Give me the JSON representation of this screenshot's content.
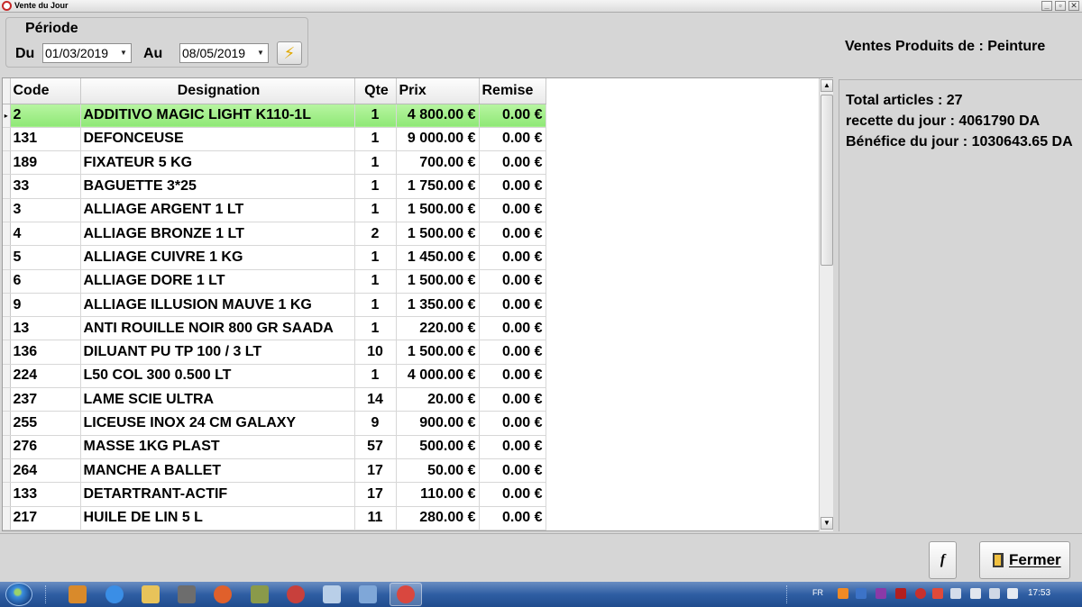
{
  "window": {
    "title": "Vente du Jour",
    "buttons": {
      "minimize": "_",
      "maximize": "▫",
      "close": "✕"
    }
  },
  "periode": {
    "title": "Période",
    "from_label": "Du",
    "from_value": "01/03/2019",
    "to_label": "Au",
    "to_value": "08/05/2019",
    "refresh_icon": "lightning-icon"
  },
  "header": {
    "ventes_label": "Ventes Produits de : Peinture"
  },
  "grid": {
    "columns": [
      "Code",
      "Designation",
      "Qte",
      "Prix",
      "Remise"
    ],
    "rows": [
      {
        "code": "2",
        "designation": "ADDITIVO MAGIC LIGHT K110-1L",
        "qte": "1",
        "prix": "4 800.00 €",
        "remise": "0.00 €",
        "selected": true
      },
      {
        "code": "131",
        "designation": "DEFONCEUSE",
        "qte": "1",
        "prix": "9 000.00 €",
        "remise": "0.00 €"
      },
      {
        "code": "189",
        "designation": "FIXATEUR 5 KG",
        "qte": "1",
        "prix": "700.00 €",
        "remise": "0.00 €"
      },
      {
        "code": "33",
        "designation": "BAGUETTE 3*25",
        "qte": "1",
        "prix": "1 750.00 €",
        "remise": "0.00 €"
      },
      {
        "code": "3",
        "designation": "ALLIAGE ARGENT 1 LT",
        "qte": "1",
        "prix": "1 500.00 €",
        "remise": "0.00 €"
      },
      {
        "code": "4",
        "designation": "ALLIAGE BRONZE 1 LT",
        "qte": "2",
        "prix": "1 500.00 €",
        "remise": "0.00 €"
      },
      {
        "code": "5",
        "designation": "ALLIAGE CUIVRE 1 KG",
        "qte": "1",
        "prix": "1 450.00 €",
        "remise": "0.00 €"
      },
      {
        "code": "6",
        "designation": "ALLIAGE DORE 1 LT",
        "qte": "1",
        "prix": "1 500.00 €",
        "remise": "0.00 €"
      },
      {
        "code": "9",
        "designation": "ALLIAGE ILLUSION MAUVE 1 KG",
        "qte": "1",
        "prix": "1 350.00 €",
        "remise": "0.00 €"
      },
      {
        "code": "13",
        "designation": "ANTI ROUILLE NOIR 800 GR SAADA",
        "qte": "1",
        "prix": "220.00 €",
        "remise": "0.00 €"
      },
      {
        "code": "136",
        "designation": "DILUANT PU TP 100 / 3 LT",
        "qte": "10",
        "prix": "1 500.00 €",
        "remise": "0.00 €"
      },
      {
        "code": "224",
        "designation": "L50 COL 300 0.500 LT",
        "qte": "1",
        "prix": "4 000.00 €",
        "remise": "0.00 €"
      },
      {
        "code": "237",
        "designation": "LAME SCIE ULTRA",
        "qte": "14",
        "prix": "20.00 €",
        "remise": "0.00 €"
      },
      {
        "code": "255",
        "designation": "LICEUSE INOX 24 CM  GALAXY",
        "qte": "9",
        "prix": "900.00 €",
        "remise": "0.00 €"
      },
      {
        "code": "276",
        "designation": "MASSE 1KG PLAST",
        "qte": "57",
        "prix": "500.00 €",
        "remise": "0.00 €"
      },
      {
        "code": "264",
        "designation": "MANCHE A BALLET",
        "qte": "17",
        "prix": "50.00 €",
        "remise": "0.00 €"
      },
      {
        "code": "133",
        "designation": "DETARTRANT-ACTIF",
        "qte": "17",
        "prix": "110.00 €",
        "remise": "0.00 €"
      },
      {
        "code": "217",
        "designation": "HUILE DE LIN 5 L",
        "qte": "11",
        "prix": "280.00 €",
        "remise": "0.00 €"
      }
    ]
  },
  "stats": {
    "total_articles": "Total articles : 27",
    "recette": "recette du jour : 4061790 DA",
    "benefice": "Bénéfice du jour : 1030643.65 DA"
  },
  "buttons": {
    "f_label": "f",
    "fermer_label": "Fermer"
  },
  "taskbar": {
    "language": "FR",
    "time": "17:53"
  },
  "colors": {
    "selected_row": "#9aee80",
    "taskbar": "#2f5ea3"
  }
}
